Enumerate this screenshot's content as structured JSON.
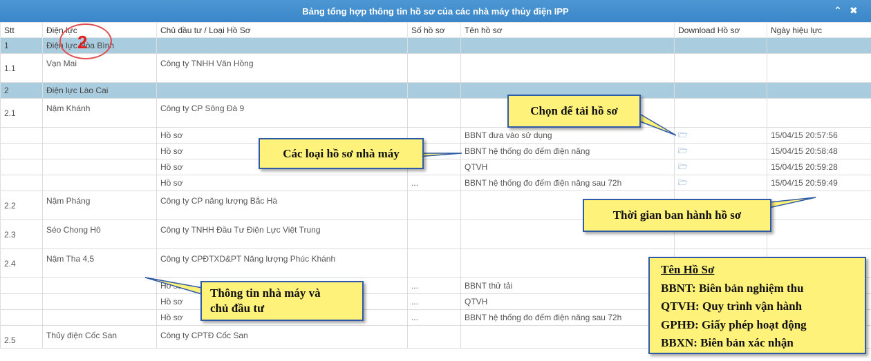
{
  "window": {
    "title": "Bảng tổng hợp thông tin hồ sơ của các nhà máy thủy điện IPP",
    "collapse_glyph": "⌃",
    "close_glyph": "✖"
  },
  "columns": [
    "Stt",
    "Điện lực",
    "Chủ đầu tư / Loại Hồ Sơ",
    "Số hồ sơ",
    "Tên hồ sơ",
    "Download Hồ sơ",
    "Ngày hiệu lực"
  ],
  "groups": [
    {
      "stt": "1",
      "name": "Điện lực Hòa Bình"
    },
    {
      "stt": "2",
      "name": "Điện lực Lào Cai"
    }
  ],
  "plants": [
    {
      "stt": "1.1",
      "name": "Vạn Mai",
      "owner": "Công ty TNHH Văn Hồng"
    },
    {
      "stt": "2.1",
      "name": "Nậm Khánh",
      "owner": "Công ty CP Sông Đà 9"
    },
    {
      "stt": "2.2",
      "name": "Nậm Pháng",
      "owner": "Công ty CP năng lượng Bắc Hà"
    },
    {
      "stt": "2.3",
      "name": "Séo Chong Hô",
      "owner": "Công ty TNHH Đầu Tư Điện Lực Việt Trung"
    },
    {
      "stt": "2.4",
      "name": "Nậm Tha 4,5",
      "owner": "Công ty CPĐTXD&PT Năng lượng Phúc Khánh"
    },
    {
      "stt": "2.5",
      "name": "Thủy điện Cốc San",
      "owner": "Công ty CPTĐ Cốc San"
    }
  ],
  "docs_2_1": [
    {
      "type": "Hồ sơ",
      "number": "",
      "name": "BBNT đưa vào sử dụng",
      "date": "15/04/15 20:57:56"
    },
    {
      "type": "Hồ sơ",
      "number": "",
      "name": "BBNT hệ thống đo đếm điện năng",
      "date": "15/04/15 20:58:48"
    },
    {
      "type": "Hồ sơ",
      "number": "",
      "name": "QTVH",
      "date": "15/04/15 20:59:28"
    },
    {
      "type": "Hồ sơ",
      "number": "...",
      "name": "BBNT hệ thống đo đếm điện năng sau 72h",
      "date": "15/04/15 20:59:49"
    }
  ],
  "docs_2_4": [
    {
      "type": "Hồ sơ",
      "number": "...",
      "name": "BBNT thử tải"
    },
    {
      "type": "Hồ sơ",
      "number": "...",
      "name": "QTVH"
    },
    {
      "type": "Hồ sơ",
      "number": "...",
      "name": "BBNT hệ thống đo đếm điện năng sau 72h"
    }
  ],
  "annotations": {
    "circle_number": "2",
    "download_note": "Chọn để tải hồ sơ",
    "doc_types_note": "Các loại hồ sơ nhà máy",
    "issue_time_note": "Thời gian ban hành hồ sơ",
    "plant_info_note_line1": "Thông tin nhà máy và",
    "plant_info_note_line2": "chủ đầu tư"
  },
  "legend": {
    "heading": "Tên Hồ Sơ",
    "items": [
      "BBNT: Biên bản nghiệm thu",
      "QTVH: Quy trình vận hành",
      "GPHĐ: Giấy phép hoạt động",
      "BBXN: Biên bản xác nhận"
    ]
  },
  "colors": {
    "titlebar": "#4490cf",
    "group_row": "#aaccdf",
    "callout_fill": "#fff27a",
    "callout_border": "#2f5aa8",
    "circle": "#e05050"
  },
  "icons": {
    "download": "folder-open-icon"
  }
}
